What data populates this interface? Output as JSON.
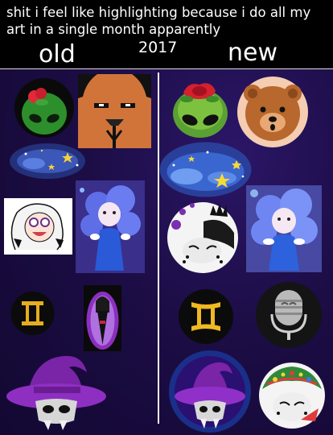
{
  "header": {
    "caption": "shit i feel like highlighting because i do all my art in a single month apparently",
    "old_label": "old",
    "year_label": "2017",
    "new_label": "new"
  },
  "artworks": {
    "old": [
      "green-alien-rose-icon",
      "bear-face-icon",
      "night-sky-stars-icon",
      "white-haired-character-icon",
      "blue-haired-character-icon",
      "gemini-symbol-icon",
      "purple-witch-figure-icon",
      "witch-hat-skull-icon"
    ],
    "new": [
      "green-alien-rose-icon",
      "bear-face-icon",
      "night-sky-stars-icon",
      "crowned-character-icon",
      "blue-haired-character-icon",
      "gemini-symbol-icon",
      "microphone-icon",
      "witch-hat-skull-icon",
      "christmas-character-icon"
    ]
  },
  "colors": {
    "header_bg": "#000000",
    "page_bg": "#1c0d45",
    "divider": "#f0f0f0"
  }
}
